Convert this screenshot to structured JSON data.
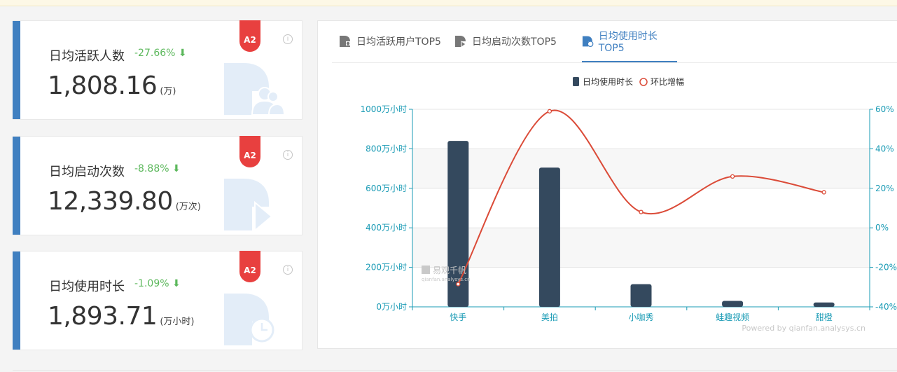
{
  "cards": [
    {
      "title": "日均活跃人数",
      "change": "-27.66%",
      "value": "1,808.16",
      "unit": "(万)",
      "badge": "A2",
      "info": "i"
    },
    {
      "title": "日均启动次数",
      "change": "-8.88%",
      "value": "12,339.80",
      "unit": "(万次)",
      "badge": "A2",
      "info": "i"
    },
    {
      "title": "日均使用时长",
      "change": "-1.09%",
      "value": "1,893.71",
      "unit": "(万小时)",
      "badge": "A2",
      "info": "i"
    }
  ],
  "tabs": [
    {
      "label": "日均活跃用户TOP5",
      "icon": "user-group-icon",
      "active": false
    },
    {
      "label": "日均启动次数TOP5",
      "icon": "play-icon",
      "active": false
    },
    {
      "label": "日均使用时长TOP5",
      "icon": "clock-icon",
      "active": true
    }
  ],
  "colors": {
    "accent": "#3f7fc0",
    "bar": "#34495e",
    "line": "#db4b38",
    "down": "#5cb85c",
    "badge": "#e8403f",
    "axis": "#1a9bb5"
  },
  "chart_data": {
    "type": "bar+line",
    "categories": [
      "快手",
      "美拍",
      "小咖秀",
      "蛙趣视频",
      "甜橙"
    ],
    "series": [
      {
        "name": "日均使用时长",
        "type": "bar",
        "axis": "left",
        "values": [
          840,
          705,
          115,
          30,
          22
        ]
      },
      {
        "name": "环比增幅",
        "type": "line",
        "axis": "right",
        "values": [
          -28.5,
          59,
          8,
          26,
          18
        ]
      }
    ],
    "y_left": {
      "ticks": [
        "0万小时",
        "200万小时",
        "400万小时",
        "600万小时",
        "800万小时",
        "1000万小时"
      ],
      "ylim": [
        0,
        1000
      ]
    },
    "y_right": {
      "ticks": [
        "-40%",
        "-20%",
        "0%",
        "20%",
        "40%",
        "60%"
      ],
      "ylim": [
        -40,
        60
      ]
    },
    "legend": "top-center",
    "watermark_text": "易观千帆",
    "watermark_sub": "qianfan.analysys.cn",
    "footer": "Powered by qianfan.analysys.cn"
  }
}
